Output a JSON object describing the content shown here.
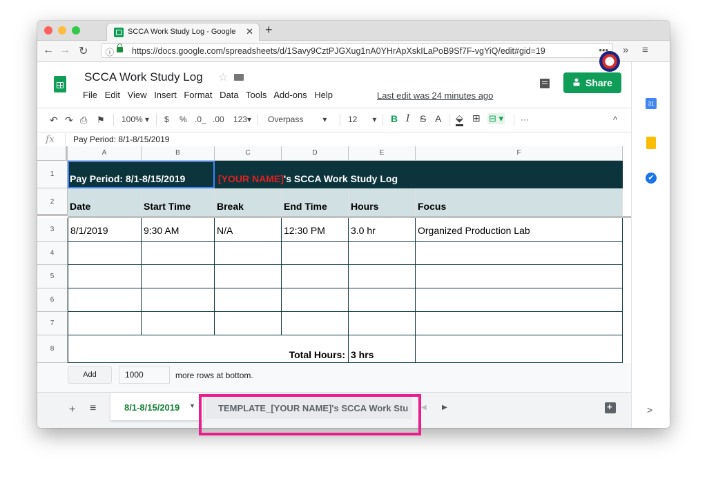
{
  "browser": {
    "tab_title": "SCCA Work Study Log - Google",
    "tab_close": "✕",
    "new_tab": "+",
    "url": "https://docs.google.com/spreadsheets/d/1Savy9CztPJGXug1nA0YHrApXskILaPoB9Sf7F-vgYiQ/edit#gid=19",
    "more_menu": "•••",
    "extensions": "»",
    "menu": "≡"
  },
  "app": {
    "title": "SCCA Work Study Log",
    "menus": [
      "File",
      "Edit",
      "View",
      "Insert",
      "Format",
      "Data",
      "Tools",
      "Add-ons",
      "Help"
    ],
    "last_edit": "Last edit was 24 minutes ago",
    "share_label": "Share"
  },
  "toolbar": {
    "zoom": "100%",
    "currency": "$",
    "percent": "%",
    "dec_less": ".0_",
    "dec_more": ".00",
    "more_formats": "123",
    "font": "Overpass",
    "font_size": "12",
    "bold": "B",
    "italic": "I",
    "strike": "S",
    "text_color": "A",
    "more": "···",
    "collapse": "^"
  },
  "formula_bar": {
    "fx": "fx",
    "content": "Pay Period: 8/1-8/15/2019"
  },
  "grid": {
    "columns": [
      "A",
      "B",
      "C",
      "D",
      "E",
      "F"
    ],
    "rows": [
      "1",
      "2",
      "3",
      "4",
      "5",
      "6",
      "7",
      "8"
    ],
    "title_left": "Pay Period: 8/1-8/15/2019",
    "title_name": "[YOUR NAME]",
    "title_rest": "'s SCCA Work Study Log",
    "headers": [
      "Date",
      "Start Time",
      "Break",
      "End Time",
      "Hours",
      "Focus"
    ],
    "row3": [
      "8/1/2019",
      "9:30 AM",
      "N/A",
      "12:30 PM",
      "3.0 hr",
      "Organized Production Lab"
    ],
    "total_label": "Total Hours:",
    "total_value": "3 hrs"
  },
  "add_rows": {
    "button": "Add",
    "count": "1000",
    "label": "more rows at bottom."
  },
  "sheets": {
    "add": "+",
    "list": "≡",
    "active": "8/1-8/15/2019",
    "active_caret": "▼",
    "template": "TEMPLATE_[YOUR NAME]'s SCCA Work Stu",
    "nav_left": "◀",
    "nav_right": "▶"
  },
  "side": {
    "calendar": "31",
    "tasks": "✔",
    "expand": ">"
  },
  "colors": {
    "header_dark": "#0c343d",
    "header_light": "#d0e0e3",
    "brand_green": "#0f9d58",
    "highlight": "#e91e8c",
    "name_red": "#e02020"
  }
}
